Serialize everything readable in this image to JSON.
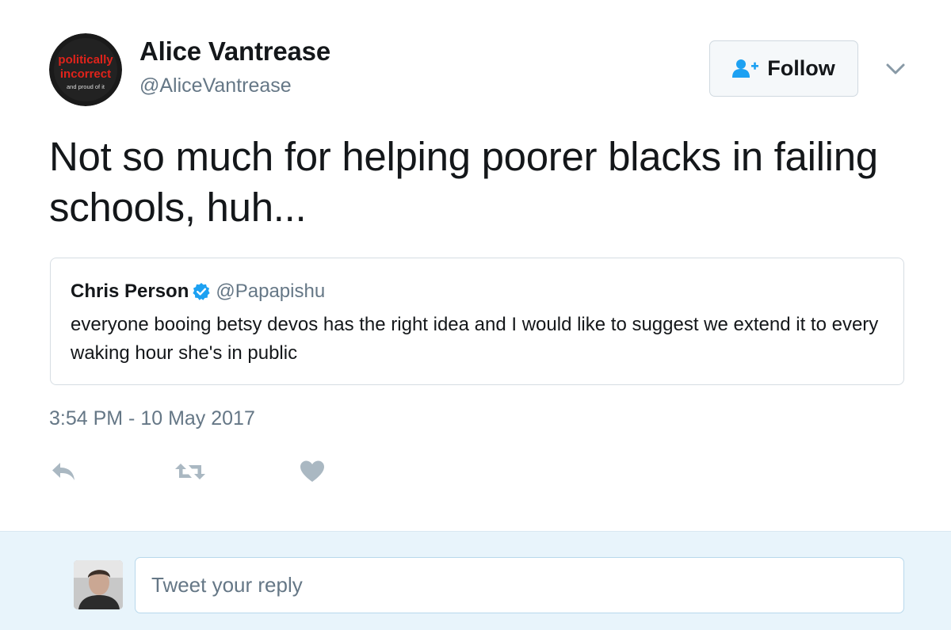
{
  "author": {
    "name": "Alice Vantrease",
    "handle": "@AliceVantrease",
    "avatar_text": [
      "politically",
      "incorrect",
      "and proud of it"
    ]
  },
  "follow_button": {
    "label": "Follow",
    "icon": "add-user-icon"
  },
  "menu": {
    "icon": "chevron-down-icon"
  },
  "tweet": {
    "text": "Not so much for helping poorer blacks in failing schools, huh...",
    "timestamp": "3:54 PM - 10 May 2017"
  },
  "quoted_tweet": {
    "name": "Chris Person",
    "verified_icon": "verified-badge-icon",
    "handle": "@Papapishu",
    "text": "everyone booing betsy devos has the right idea and I would like to suggest we extend it to every waking hour she's in public"
  },
  "actions": [
    {
      "name": "reply",
      "icon": "reply-icon"
    },
    {
      "name": "retweet",
      "icon": "retweet-icon"
    },
    {
      "name": "like",
      "icon": "heart-icon"
    }
  ],
  "reply_box": {
    "placeholder": "Tweet your reply"
  },
  "colors": {
    "text_primary": "#14171a",
    "text_secondary": "#657786",
    "action_gray": "#aab8c2",
    "accent_blue": "#1da1f2",
    "reply_bg": "#e8f4fb"
  }
}
